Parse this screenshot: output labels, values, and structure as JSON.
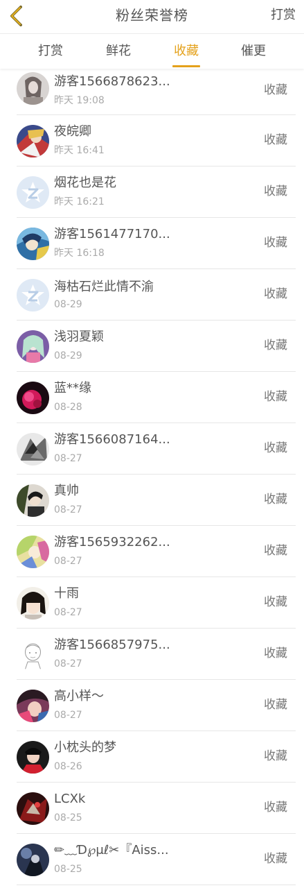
{
  "header": {
    "title": "粉丝荣誉榜",
    "action_label": "打赏"
  },
  "tabs": [
    {
      "label": "打赏",
      "active": false
    },
    {
      "label": "鲜花",
      "active": false
    },
    {
      "label": "收藏",
      "active": true
    },
    {
      "label": "催更",
      "active": false
    }
  ],
  "colors": {
    "accent": "#e4a11b",
    "text": "#555555",
    "muted": "#aaaaaa"
  },
  "list": [
    {
      "name": "游客1566878623...",
      "time": "昨天 19:08",
      "action": "收藏",
      "avatar": "gray-woman"
    },
    {
      "name": "夜皖卿",
      "time": "昨天 16:41",
      "action": "收藏",
      "avatar": "anime-red"
    },
    {
      "name": "烟花也是花",
      "time": "昨天 16:21",
      "action": "收藏",
      "avatar": "default-star"
    },
    {
      "name": "游客1561477170...",
      "time": "昨天 16:18",
      "action": "收藏",
      "avatar": "anime-blue"
    },
    {
      "name": "海枯石烂此情不渝",
      "time": "08-29",
      "action": "收藏",
      "avatar": "default-star"
    },
    {
      "name": "浅羽夏颖",
      "time": "08-29",
      "action": "收藏",
      "avatar": "anime-purple"
    },
    {
      "name": "蓝**缘",
      "time": "08-28",
      "action": "收藏",
      "avatar": "flower-pink"
    },
    {
      "name": "游客1566087164...",
      "time": "08-27",
      "action": "收藏",
      "avatar": "sketch-gray"
    },
    {
      "name": "真帅",
      "time": "08-27",
      "action": "收藏",
      "avatar": "anime-dark"
    },
    {
      "name": "游客1565932262...",
      "time": "08-27",
      "action": "收藏",
      "avatar": "anime-yellow"
    },
    {
      "name": "十雨",
      "time": "08-27",
      "action": "收藏",
      "avatar": "girl-bangs"
    },
    {
      "name": "游客1566857975...",
      "time": "08-27",
      "action": "收藏",
      "avatar": "line-drawing"
    },
    {
      "name": "高小样～",
      "time": "08-27",
      "action": "收藏",
      "avatar": "photo-pink"
    },
    {
      "name": "小枕头的梦",
      "time": "08-26",
      "action": "收藏",
      "avatar": "photo-red"
    },
    {
      "name": "LCXk",
      "time": "08-25",
      "action": "收藏",
      "avatar": "dark-red"
    },
    {
      "name": "✏﹏Ɗ℘μℓ✂『Aiss...",
      "time": "08-25",
      "action": "收藏",
      "avatar": "dark-blue"
    }
  ]
}
